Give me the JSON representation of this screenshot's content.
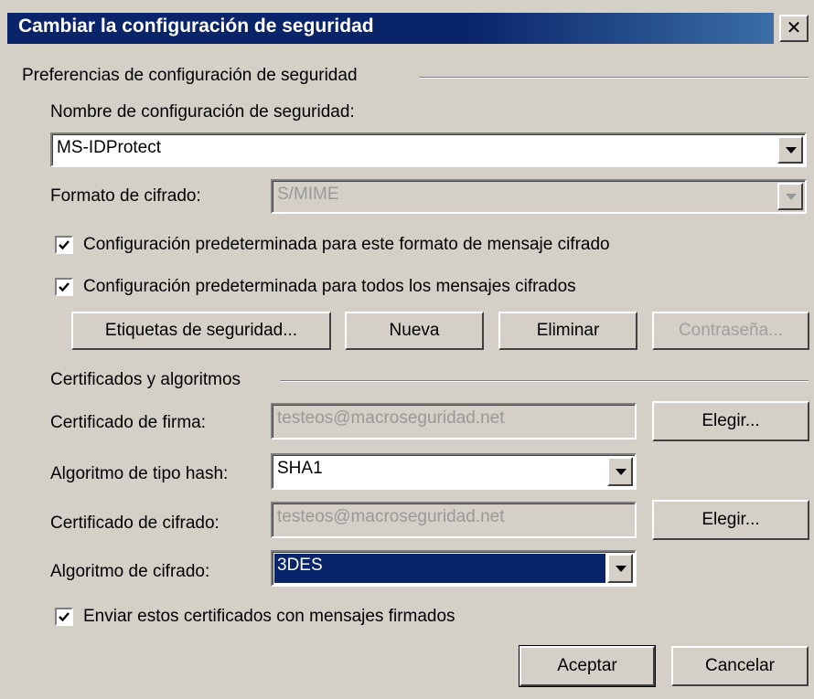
{
  "dialog": {
    "title": "Cambiar la configuración de seguridad",
    "close_glyph": "✕"
  },
  "preferences": {
    "group_label": "Preferencias de configuración de seguridad",
    "name_label": "Nombre de configuración de seguridad:",
    "name_value": "MS-IDProtect",
    "format_label": "Formato de cifrado:",
    "format_value": "S/MIME",
    "default_format_checkbox": {
      "label": "Configuración predeterminada para este formato de mensaje cifrado",
      "checked": true
    },
    "default_all_checkbox": {
      "label": "Configuración predeterminada para todos los mensajes cifrados",
      "checked": true
    },
    "buttons": {
      "labels": "Etiquetas de seguridad...",
      "new": "Nueva",
      "delete": "Eliminar",
      "password": "Contraseña..."
    }
  },
  "certificates": {
    "group_label": "Certificados y algoritmos",
    "signing_cert_label": "Certificado de firma:",
    "signing_cert_value": "testeos@macroseguridad.net",
    "signing_choose": "Elegir...",
    "hash_label": "Algoritmo de tipo hash:",
    "hash_value": "SHA1",
    "encryption_cert_label": "Certificado de cifrado:",
    "encryption_cert_value": "testeos@macroseguridad.net",
    "encryption_choose": "Elegir...",
    "encryption_alg_label": "Algoritmo de cifrado:",
    "encryption_alg_value": "3DES",
    "send_certs_checkbox": {
      "label": "Enviar estos certificados con mensajes firmados",
      "checked": true
    }
  },
  "footer": {
    "ok": "Aceptar",
    "cancel": "Cancelar"
  },
  "colors": {
    "title_bar": "#0a246a",
    "face": "#d4d0c8",
    "selection": "#0a246a"
  }
}
